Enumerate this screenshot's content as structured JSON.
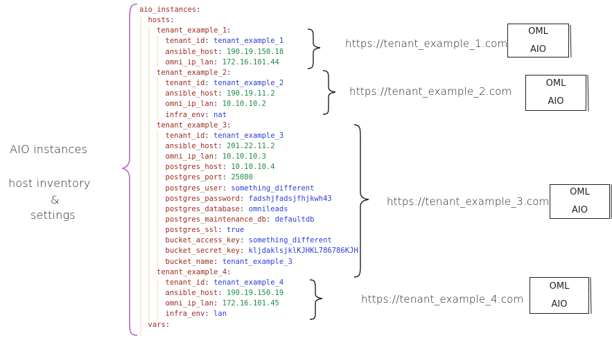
{
  "yaml_lines": [
    {
      "indent": 0,
      "key": "aio_instances",
      "value": "",
      "vtype": ""
    },
    {
      "indent": 1,
      "key": "hosts",
      "value": "",
      "vtype": ""
    },
    {
      "indent": 2,
      "key": "tenant_example_1",
      "value": "",
      "vtype": ""
    },
    {
      "indent": 3,
      "key": "tenant_id",
      "value": "tenant_example_1",
      "vtype": "s"
    },
    {
      "indent": 3,
      "key": "ansible_host",
      "value": "190.19.150.18",
      "vtype": "n"
    },
    {
      "indent": 3,
      "key": "omni_ip_lan",
      "value": "172.16.101.44",
      "vtype": "n"
    },
    {
      "indent": 2,
      "key": "tenant_example_2",
      "value": "",
      "vtype": ""
    },
    {
      "indent": 3,
      "key": "tenant_id",
      "value": "tenant_example_2",
      "vtype": "s"
    },
    {
      "indent": 3,
      "key": "ansible_host",
      "value": "190.19.11.2",
      "vtype": "n"
    },
    {
      "indent": 3,
      "key": "omni_ip_lan",
      "value": "10.10.10.2",
      "vtype": "n"
    },
    {
      "indent": 3,
      "key": "infra_env",
      "value": "nat",
      "vtype": "s"
    },
    {
      "indent": 2,
      "key": "tenant_example_3",
      "value": "",
      "vtype": ""
    },
    {
      "indent": 3,
      "key": "tenant_id",
      "value": "tenant_example_3",
      "vtype": "s"
    },
    {
      "indent": 3,
      "key": "ansible_host",
      "value": "201.22.11.2",
      "vtype": "n"
    },
    {
      "indent": 3,
      "key": "omni_ip_lan",
      "value": "10.10.10.3",
      "vtype": "n"
    },
    {
      "indent": 3,
      "key": "postgres_host",
      "value": "10.10.10.4",
      "vtype": "n"
    },
    {
      "indent": 3,
      "key": "postgres_port",
      "value": "25080",
      "vtype": "n"
    },
    {
      "indent": 3,
      "key": "postgres_user",
      "value": "something_different",
      "vtype": "s"
    },
    {
      "indent": 3,
      "key": "postgres_password",
      "value": "fadshjfadsjfhjkwh43",
      "vtype": "s"
    },
    {
      "indent": 3,
      "key": "postgres_database",
      "value": "omnileads",
      "vtype": "s"
    },
    {
      "indent": 3,
      "key": "postgres_maintenance_db",
      "value": "defaultdb",
      "vtype": "s"
    },
    {
      "indent": 3,
      "key": "postgres_ssl",
      "value": "true",
      "vtype": "s"
    },
    {
      "indent": 3,
      "key": "bucket_access_key",
      "value": "something_different",
      "vtype": "s"
    },
    {
      "indent": 3,
      "key": "bucket_secret_key",
      "value": "kljdaklsjklKJHKL786786KJH.",
      "vtype": "s"
    },
    {
      "indent": 3,
      "key": "bucket_name",
      "value": "tenant_example_3",
      "vtype": "s"
    },
    {
      "indent": 2,
      "key": "tenant_example_4",
      "value": "",
      "vtype": ""
    },
    {
      "indent": 3,
      "key": "tenant_id",
      "value": "tenant_example_4",
      "vtype": "s"
    },
    {
      "indent": 3,
      "key": "ansible_host",
      "value": "190.19.150.19",
      "vtype": "n"
    },
    {
      "indent": 3,
      "key": "omni_ip_lan",
      "value": "172.16.101.45",
      "vtype": "n"
    },
    {
      "indent": 3,
      "key": "infra_env",
      "value": "lan",
      "vtype": "s"
    },
    {
      "indent": 1,
      "key": "vars",
      "value": "",
      "vtype": ""
    }
  ],
  "left_labels": {
    "line1": "AIO instances",
    "line2": "host inventory",
    "line3": "&",
    "line4": "settings"
  },
  "urls": [
    "https://tenant_example_1.com",
    "https://tenant_example_2.com",
    "https://tenant_example_3.com",
    "https://tenant_example_4.com"
  ],
  "boxes": [
    {
      "line1": "OML",
      "line2": "AIO"
    },
    {
      "line1": "OML",
      "line2": "AIO"
    },
    {
      "line1": "OML",
      "line2": "AIO"
    },
    {
      "line1": "OML",
      "line2": "AIO"
    }
  ],
  "colors": {
    "key": "#9e2a1f",
    "string_value": "#2a3ed8",
    "number_value": "#1f8a4c",
    "guide_lines": "#e7e1a0",
    "brace": "#b46ab8"
  }
}
